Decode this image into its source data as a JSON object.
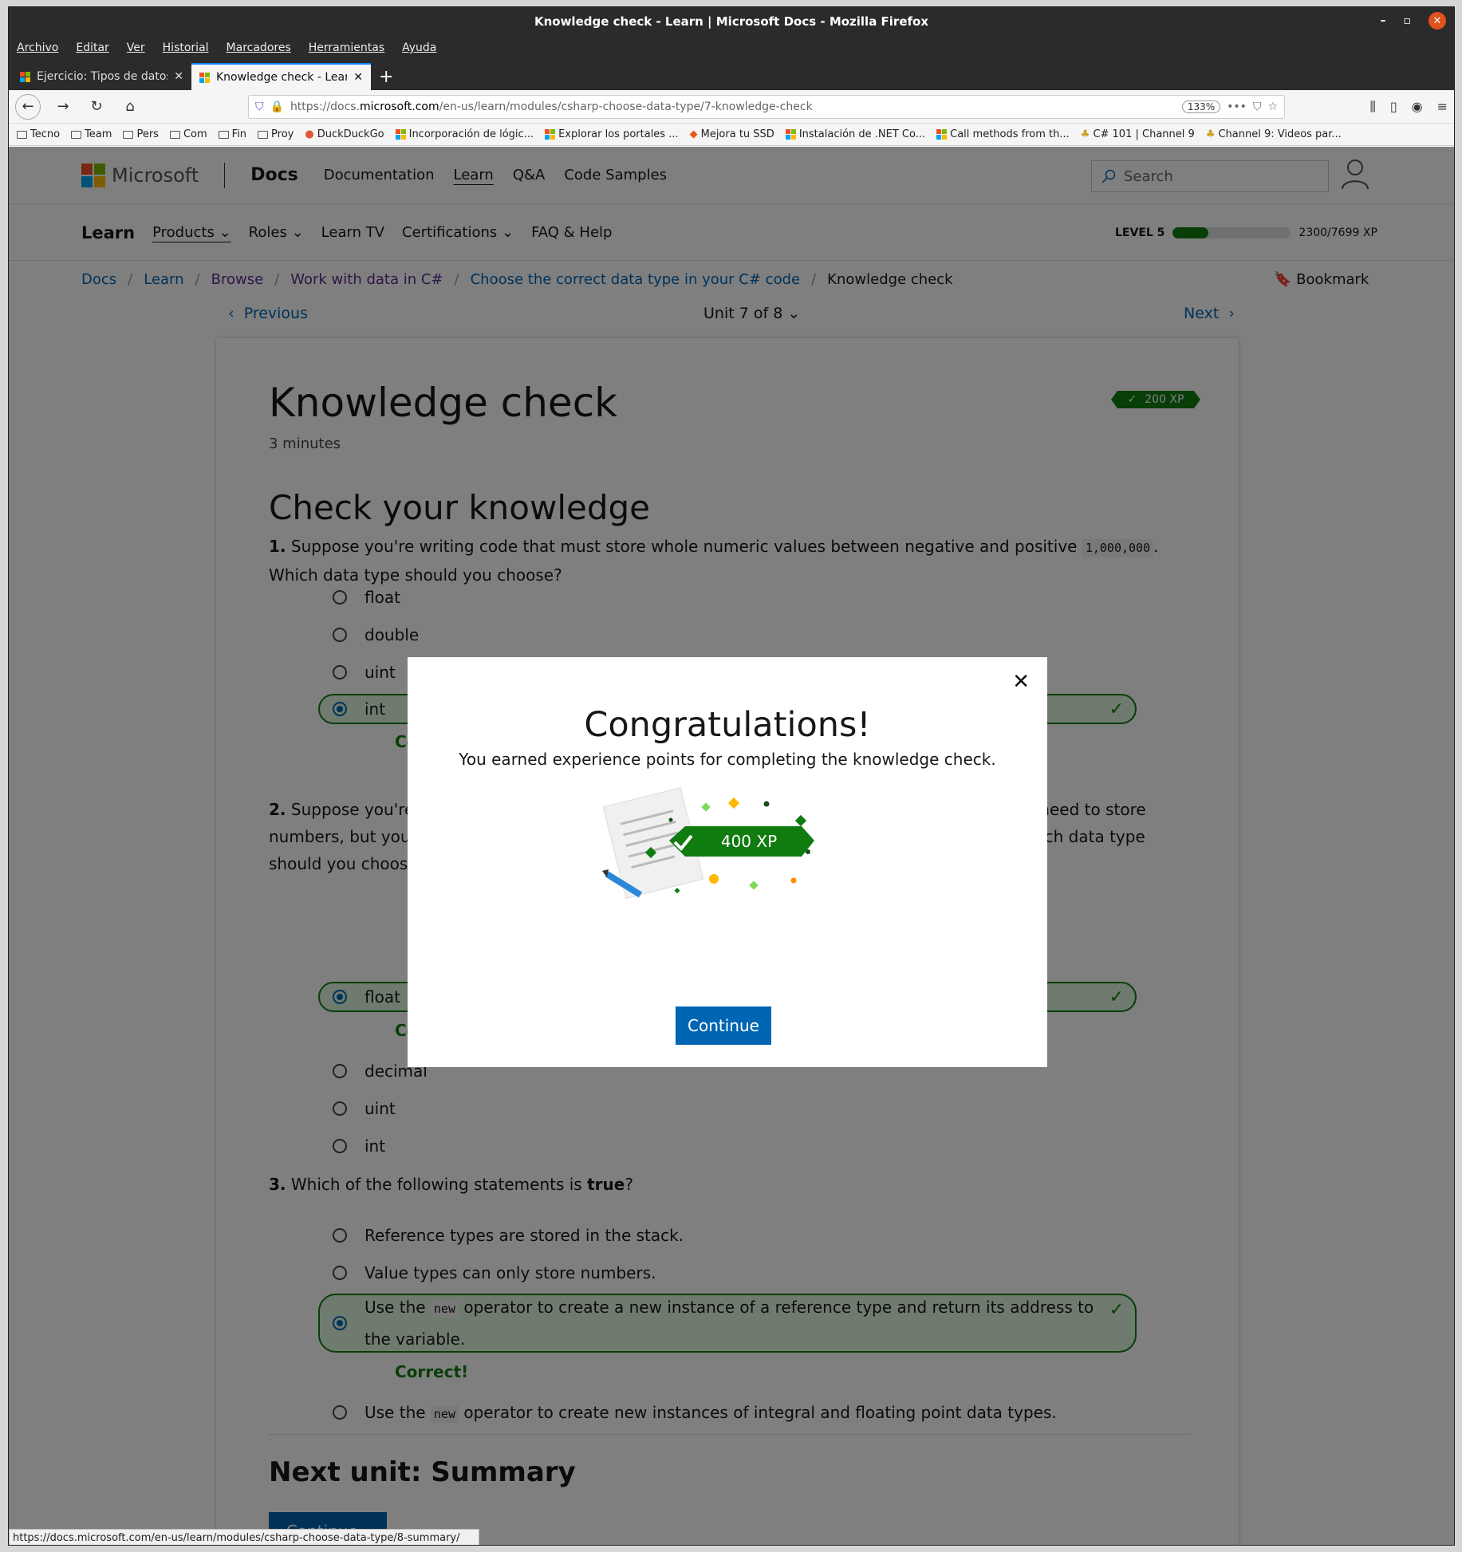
{
  "window": {
    "title": "Knowledge check - Learn | Microsoft Docs - Mozilla Firefox",
    "min": "–",
    "max": "▫",
    "close": "✕"
  },
  "menu": [
    "Archivo",
    "Editar",
    "Ver",
    "Historial",
    "Marcadores",
    "Herramientas",
    "Ayuda"
  ],
  "tabs": [
    {
      "title": "Ejercicio: Tipos de datos"
    },
    {
      "title": "Knowledge check - Learn"
    }
  ],
  "urlbar": {
    "prefix": "https://docs.",
    "domain": "microsoft.com",
    "path": "/en-us/learn/modules/csharp-choose-data-type/7-knowledge-check",
    "zoom": "133%"
  },
  "bookmarks": [
    "Tecno",
    "Team",
    "Pers",
    "Com",
    "Fin",
    "Proy",
    "DuckDuckGo",
    "Incorporación de lógic...",
    "Explorar los portales ...",
    "Mejora tu SSD",
    "Instalación de .NET Co...",
    "Call methods from th...",
    "C# 101 | Channel 9",
    "Channel 9: Videos par..."
  ],
  "header": {
    "brand": "Microsoft",
    "docs": "Docs",
    "nav": [
      "Documentation",
      "Learn",
      "Q&A",
      "Code Samples"
    ],
    "search_placeholder": "Search"
  },
  "learnbar": {
    "title": "Learn",
    "items": [
      "Products",
      "Roles",
      "Learn TV",
      "Certifications",
      "FAQ & Help"
    ],
    "level": "LEVEL 5",
    "xp": "2300/7699 XP",
    "xp_fraction": 0.299
  },
  "breadcrumb": {
    "items": [
      "Docs",
      "Learn",
      "Browse",
      "Work with data in C#",
      "Choose the correct data type in your C# code"
    ],
    "current": "Knowledge check"
  },
  "bookmark_label": "Bookmark",
  "unitnav": {
    "prev": "Previous",
    "unit": "Unit 7 of 8",
    "next": "Next"
  },
  "content": {
    "title": "Knowledge check",
    "duration": "3 minutes",
    "xp_badge": "200 XP",
    "section": "Check your knowledge",
    "q1": {
      "num": "1.",
      "text_a": "Suppose you're writing code that must store whole numeric values between negative and positive",
      "code": "1,000,000",
      "text_b": ". Which data type should you choose?",
      "options": [
        "float",
        "double",
        "uint",
        "int"
      ],
      "correct": "Correct!"
    },
    "q2": {
      "num": "2.",
      "text": "Suppose you're writing code for a game that tracks positions in a large 3D space. You'll likely need to store numbers, but you're not concerned about absolute precision, and you want to save memory. Which data type should you choose?",
      "options": [
        "float",
        "decimal",
        "uint",
        "int"
      ],
      "correct": "Correct!"
    },
    "q3": {
      "num": "3.",
      "text_a": "Which of the following statements is",
      "bold": "true",
      "text_b": "?",
      "opt1": "Reference types are stored in the stack.",
      "opt2": "Value types can only store numbers.",
      "opt3_a": "Use the",
      "opt3_code": "new",
      "opt3_b": "operator to create a new instance of a reference type and return its address to the variable.",
      "opt4_a": "Use the",
      "opt4_code": "new",
      "opt4_b": "operator to create new instances of integral and floating point data types.",
      "correct": "Correct!"
    },
    "next_unit": "Next unit: Summary",
    "continue": "Continue ›"
  },
  "modal": {
    "title": "Congratulations!",
    "subtitle": "You earned experience points for completing the knowledge check.",
    "xp": "400 XP",
    "button": "Continue"
  },
  "statusbar": "https://docs.microsoft.com/en-us/learn/modules/csharp-choose-data-type/8-summary/",
  "colors": {
    "accent": "#0065b3",
    "success": "#107c10",
    "overlay": "rgba(0,0,0,0.5)"
  }
}
